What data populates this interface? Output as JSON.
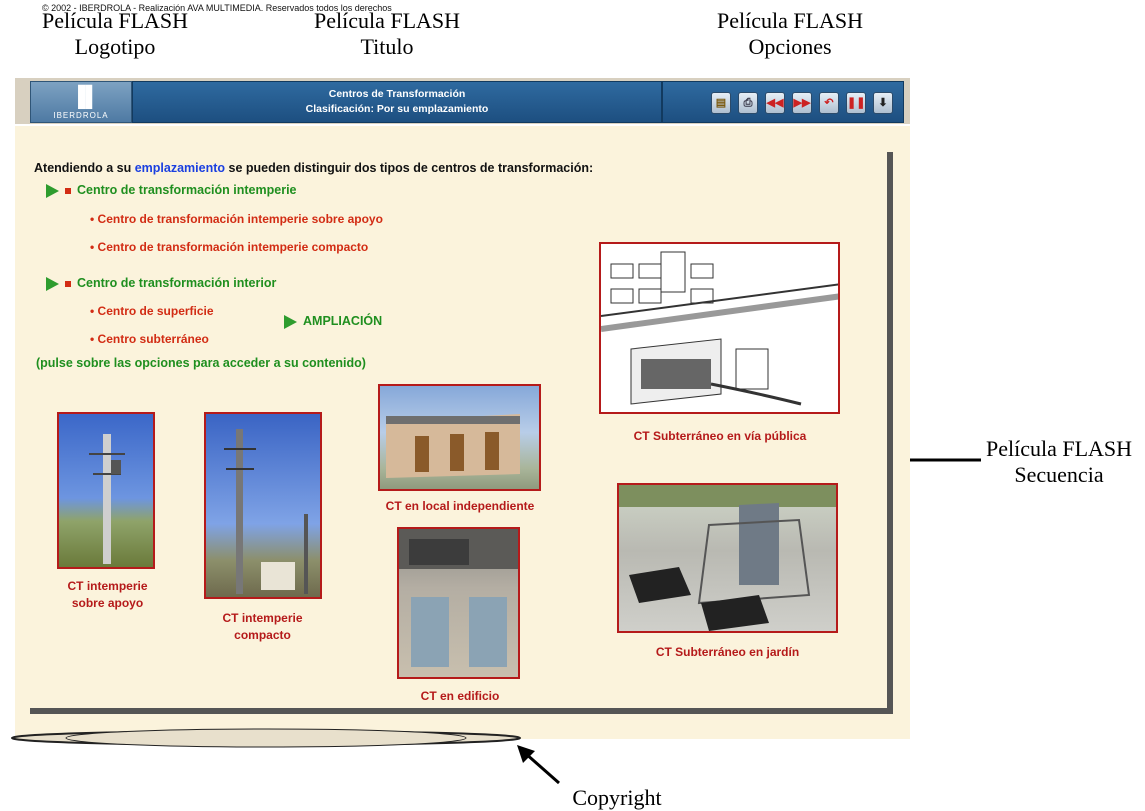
{
  "annotations": {
    "logo": [
      "Película FLASH",
      "Logotipo"
    ],
    "title": [
      "Película FLASH",
      "Titulo"
    ],
    "options": [
      "Película FLASH",
      "Opciones"
    ],
    "sequence": [
      "Película FLASH",
      "Secuencia"
    ],
    "copyright": "Copyright"
  },
  "header": {
    "logo_text": "IBERDROLA",
    "title_line1": "Centros de Transformación",
    "title_line2": "Clasificación: Por su emplazamiento",
    "option_icons": [
      "document-icon",
      "print-icon",
      "rewind-icon",
      "fast-forward-icon",
      "back-icon",
      "pause-icon",
      "down-icon"
    ]
  },
  "content": {
    "intro_before": "Atendiendo a su ",
    "intro_keyword": "emplazamiento",
    "intro_after": " se pueden distinguir dos tipos de centros de transformación:",
    "group1_title": "Centro de transformación intemperie",
    "group1_items": [
      "• Centro de transformación intemperie sobre apoyo",
      "• Centro de transformación intemperie compacto"
    ],
    "group2_title": "Centro de transformación interior",
    "group2_items": [
      "• Centro de superficie",
      "• Centro subterráneo"
    ],
    "ampliacion": "AMPLIACIÓN",
    "hint": "(pulse sobre las opciones para acceder a su contenido)"
  },
  "photos": {
    "apoyo_l1": "CT intemperie",
    "apoyo_l2": "sobre apoyo",
    "compacto_l1": "CT intemperie",
    "compacto_l2": "compacto",
    "local": "CT en local independiente",
    "edificio": "CT en edificio",
    "via_publica": "CT Subterráneo en vía pública",
    "jardin": "CT Subterráneo en jardín"
  },
  "footer": {
    "copyright_text": "© 2002 - IBERDROLA - Realización AVA MULTIMEDIA. Reservados todos los derechos"
  },
  "colors": {
    "panel_bg": "#fbf3dc",
    "header_blue": "#1d4f80",
    "accent_green": "#1f8f1f",
    "accent_red": "#d22c14",
    "frame_red": "#b51a1a",
    "keyword_blue": "#1a3fe0"
  }
}
